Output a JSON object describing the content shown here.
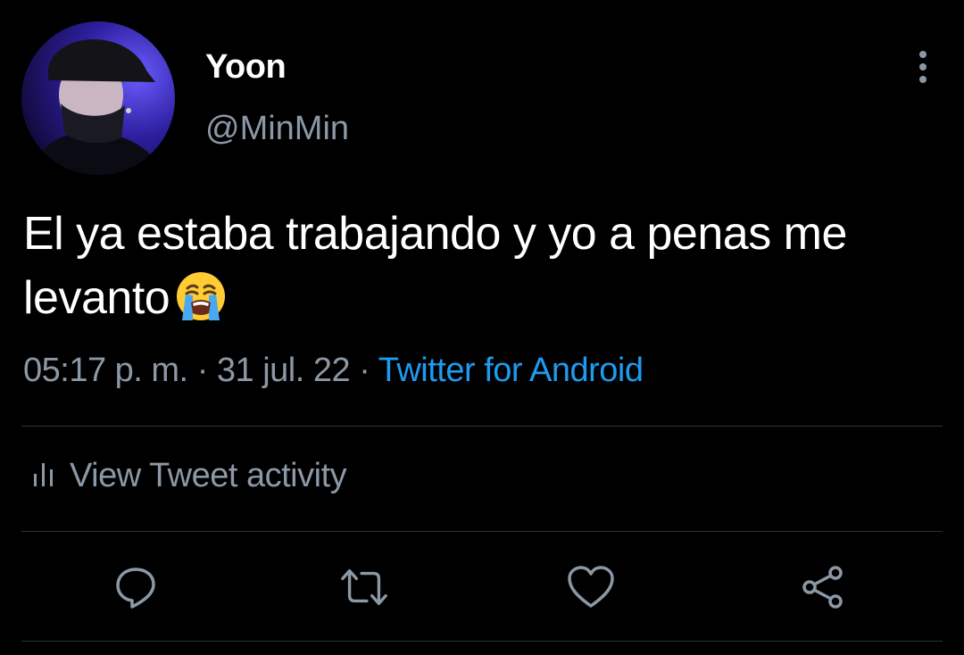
{
  "tweet": {
    "author": {
      "display_name": "Yoon",
      "handle": "@MinMin"
    },
    "text": "El ya estaba trabajando y yo a penas me levanto",
    "emoji": "loudly-crying-face",
    "time": "05:17 p. m.",
    "separator": "·",
    "date": "31 jul. 22",
    "source": "Twitter for Android",
    "activity_label": "View Tweet activity"
  },
  "icons": {
    "more": "more-vertical-icon",
    "activity": "bar-chart-icon",
    "reply": "reply-icon",
    "retweet": "retweet-icon",
    "like": "heart-icon",
    "share": "share-icon"
  },
  "colors": {
    "background": "#000000",
    "primary_text": "#ffffff",
    "secondary_text": "#8b98a5",
    "link": "#1d9bf0",
    "divider": "#2f3336"
  }
}
